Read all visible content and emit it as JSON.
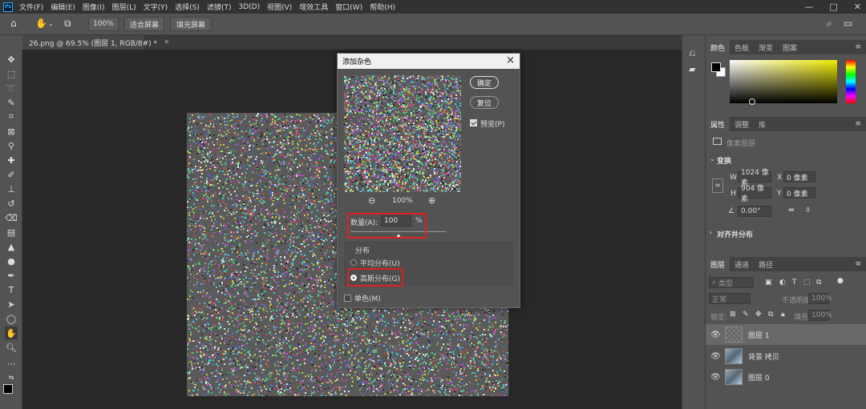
{
  "app": {
    "logo": "Ps"
  },
  "menu": [
    "文件(F)",
    "编辑(E)",
    "图像(I)",
    "图层(L)",
    "文字(Y)",
    "选择(S)",
    "滤镜(T)",
    "3D(D)",
    "视图(V)",
    "增效工具",
    "窗口(W)",
    "帮助(H)"
  ],
  "window_controls": {
    "minimize": "—",
    "maximize": "□",
    "close": "✕"
  },
  "options": {
    "zoom": "100%",
    "fit_screen": "适合屏幕",
    "fill_screen": "填充屏幕"
  },
  "document": {
    "tab_title": "26.png @ 69.5% (图层 1, RGB/8#) *",
    "close": "×"
  },
  "dialog": {
    "title": "添加杂色",
    "close": "×",
    "ok": "确定",
    "reset": "复位",
    "preview_label": "预览(P)",
    "zoom_level": "100%",
    "amount_label": "数量(A):",
    "amount_value": "100",
    "amount_unit": "%",
    "amount_fraction": 0.5,
    "distribution_label": "分布",
    "uniform": "平均分布(U)",
    "gaussian": "高斯分布(G)",
    "monochrome": "单色(M)",
    "selected_distribution": "gaussian"
  },
  "color_panel": {
    "tabs": [
      "颜色",
      "色板",
      "渐变",
      "图案"
    ]
  },
  "properties_panel": {
    "tabs": [
      "属性",
      "调整",
      "库"
    ],
    "layer_type": "像素图层",
    "transform_title": "变换",
    "w_label": "W",
    "w_value": "1024 像素",
    "h_label": "H",
    "h_value": "904 像素",
    "x_label": "X",
    "x_value": "0 像素",
    "y_label": "Y",
    "y_value": "0 像素",
    "angle": "0.00°",
    "align_title": "对齐并分布"
  },
  "layers_panel": {
    "tabs": [
      "图层",
      "通道",
      "路径"
    ],
    "filter_type": "类型",
    "blend_mode": "正常",
    "opacity_label": "不透明度:",
    "opacity_value": "100%",
    "lock_label": "锁定:",
    "fill_label": "填充:",
    "fill_value": "100%",
    "layers": [
      {
        "name": "图层 1",
        "selected": true,
        "thumb": "blank"
      },
      {
        "name": "背景 拷贝",
        "selected": false,
        "thumb": "img"
      },
      {
        "name": "图层 0",
        "selected": false,
        "thumb": "img"
      }
    ]
  },
  "colors": {
    "accent": "#31a8ff",
    "highlight": "#e02020",
    "dialog_title_bg": "#f0f0f0"
  }
}
